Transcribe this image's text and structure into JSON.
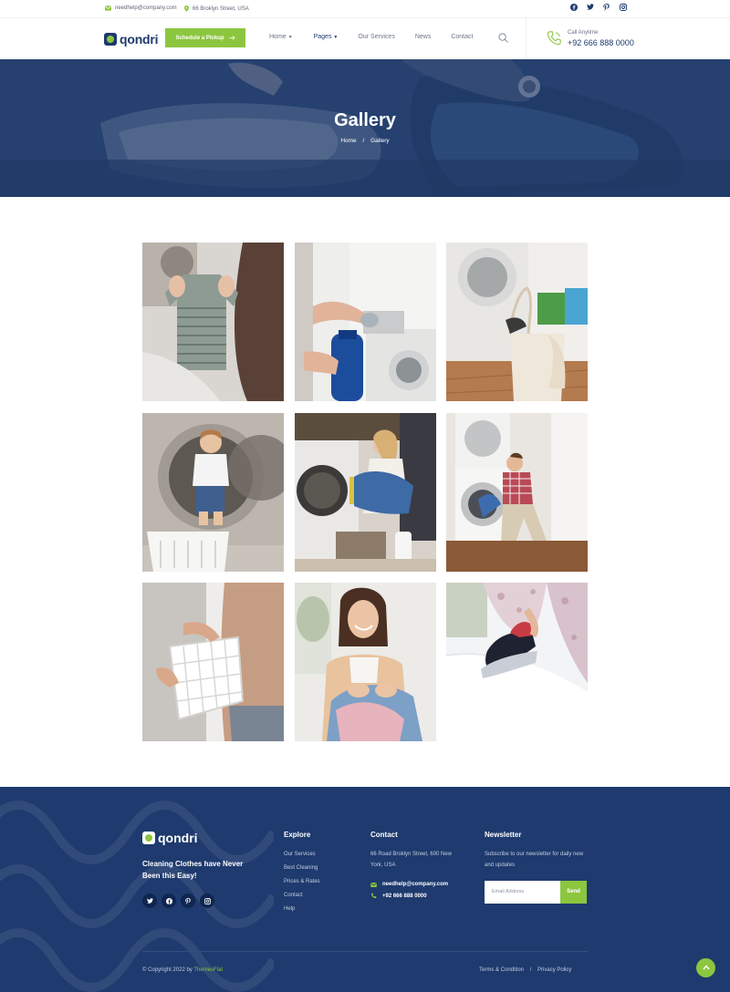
{
  "colors": {
    "brand_navy": "#1e3a6e",
    "accent_green": "#8cc63f"
  },
  "topbar": {
    "email": "needhelp@company.com",
    "address": "66 Broklyn Street, USA",
    "socials": [
      "facebook-icon",
      "twitter-icon",
      "pinterest-icon",
      "instagram-icon"
    ]
  },
  "header": {
    "logo_text": "qondri",
    "pickup_label": "Schedule a Pickup",
    "menu": [
      "Home",
      "Pages",
      "Our Services",
      "News",
      "Contact"
    ],
    "active_menu": "Pages",
    "call_label": "Call Anytime",
    "call_number": "+92 666 888 0000"
  },
  "hero": {
    "title": "Gallery",
    "breadcrumb": [
      "Home",
      "Gallery"
    ],
    "separator": "/"
  },
  "gallery": {
    "items": [
      {
        "subject": "baby clothes held up"
      },
      {
        "subject": "detergent poured into washer"
      },
      {
        "subject": "laundry basket and detergent boxes"
      },
      {
        "subject": "boy sitting in washing machine"
      },
      {
        "subject": "woman folding clothes by washer"
      },
      {
        "subject": "man loading washing machine"
      },
      {
        "subject": "laundry basket carried"
      },
      {
        "subject": "woman sorting laundry"
      },
      {
        "subject": "ironing a white shirt"
      }
    ]
  },
  "footer": {
    "logo_text": "qondri",
    "tagline": "Cleaning Clothes have Never Been this Easy!",
    "socials": [
      "twitter-icon",
      "facebook-icon",
      "pinterest-icon",
      "instagram-icon"
    ],
    "explore": {
      "title": "Explore",
      "links": [
        "Our Services",
        "Best Cleaning",
        "Prices & Rates",
        "Contact",
        "Help"
      ]
    },
    "contact": {
      "title": "Contact",
      "address": "66 Road Broklyn Street, 600 New York, USA",
      "email": "needhelp@company.com",
      "phone": "+92 666 888 0000"
    },
    "newsletter": {
      "title": "Newsletter",
      "text": "Subscribe to our newsletter for daily new and updates",
      "placeholder": "Email Address",
      "button": "Send"
    },
    "copyright_prefix": "© Copyright 2022 by",
    "copyright_brand": "ThemesFlat",
    "legal": [
      "Terms & Condition",
      "Privacy Policy"
    ],
    "legal_separator": "/"
  }
}
